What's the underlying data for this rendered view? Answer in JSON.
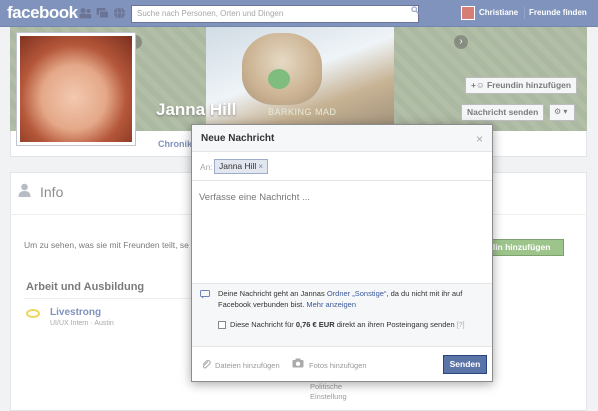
{
  "topbar": {
    "logo": "facebook",
    "search_placeholder": "Suche nach Personen, Orten und Dingen",
    "user_name": "Christiane",
    "find_friends": "Freunde finden"
  },
  "cover": {
    "profile_name": "Janna Hill",
    "photo_caption": "BARKING MAD",
    "add_friend_label": "Freundin hinzufügen",
    "send_message_label": "Nachricht senden"
  },
  "timeline": {
    "tab_chronik": "Chronik",
    "info_title": "Info",
    "info_text": "Um zu sehen, was sie mit Freunden teilt, se",
    "add_friend_green": "din hinzufügen",
    "section_title": "Arbeit und Ausbildung",
    "work_name": "Livestrong",
    "work_sub": "UI/UX Intern · Austin",
    "side_item_1": "Politische",
    "side_item_2": "Einstellung"
  },
  "dialog": {
    "title": "Neue Nachricht",
    "to_label": "An:",
    "recipient": "Janna Hill",
    "message_placeholder": "Verfasse eine Nachricht ...",
    "notice_part1": "Deine Nachricht geht an Jannas ",
    "notice_link1": "Ordner „Sonstige“",
    "notice_part2": ", da du nicht mit ihr auf Facebook verbunden bist. ",
    "notice_link2": "Mehr anzeigen",
    "checkbox_part1": "Diese Nachricht für ",
    "checkbox_price": "0,76 € EUR",
    "checkbox_part2": " direkt an ihren Posteingang senden",
    "checkbox_help": "[?]",
    "attach_label": "Dateien hinzufügen",
    "photo_label": "Fotos hinzufügen",
    "send_label": "Senden"
  },
  "icons": {
    "friend_requests": "friends-icon",
    "messages": "messages-icon",
    "notifications": "globe-icon",
    "search": "search-icon",
    "close": "close-icon",
    "gear": "gear-icon"
  },
  "colors": {
    "brand": "#3b5998",
    "send_button": "#5b74a8",
    "green_button": "#69a74e"
  }
}
